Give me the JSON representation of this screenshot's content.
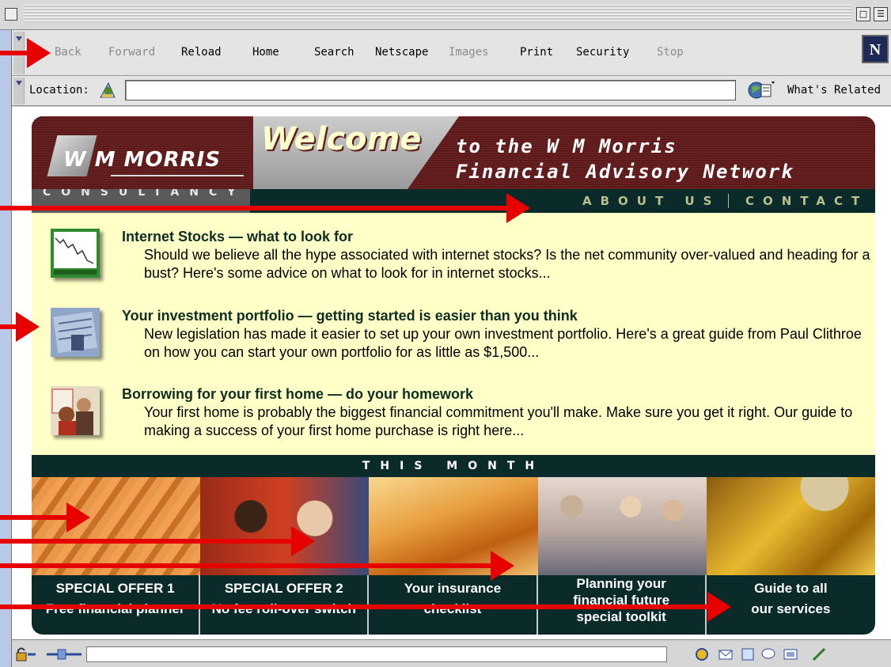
{
  "browser": {
    "nav_buttons": [
      {
        "label": "Back",
        "enabled": false
      },
      {
        "label": "Forward",
        "enabled": false
      },
      {
        "label": "Reload",
        "enabled": true
      },
      {
        "label": "Home",
        "enabled": true
      },
      {
        "label": "Search",
        "enabled": true
      },
      {
        "label": "Netscape",
        "enabled": true
      },
      {
        "label": "Images",
        "enabled": false
      },
      {
        "label": "Print",
        "enabled": true
      },
      {
        "label": "Security",
        "enabled": true
      },
      {
        "label": "Stop",
        "enabled": false
      }
    ],
    "netscape_logo": "N",
    "location_label": "Location:",
    "location_value": "",
    "whats_related": "What's Related"
  },
  "page": {
    "logo_text": "W M MORRIS",
    "logo_subtitle": "CONSULTANCY",
    "welcome": "Welcome",
    "tagline_line1": "to the W M Morris",
    "tagline_line2": "Financial Advisory Network",
    "nav": {
      "about": "ABOUT US",
      "contact": "CONTACT"
    },
    "articles": [
      {
        "title": "Internet Stocks — what to look for",
        "body": "Should we believe all the hype associated with internet stocks? Is the net community over-valued and heading for a bust? Here's some advice on what to look for in internet stocks...",
        "icon": "stock-chart-icon"
      },
      {
        "title": "Your investment portfolio — getting started is easier than you think",
        "body": "New legislation has made it easier to set up your own investment portfolio. Here's a great guide from Paul Clithroe on how you can start your own portfolio for as little as $1,500...",
        "icon": "portfolio-icon"
      },
      {
        "title": "Borrowing for your first home — do your homework",
        "body": "Your first home is probably the biggest financial commitment you'll make. Make sure you get it right. Our guide to making a success of your first home purchase is right here...",
        "icon": "first-home-icon"
      }
    ],
    "this_month": "THIS MONTH",
    "offers": [
      {
        "line1": "SPECIAL OFFER 1",
        "line2": "Free financial planner",
        "line3": ""
      },
      {
        "line1": "SPECIAL OFFER 2",
        "line2": "No fee roll-over switch",
        "line3": ""
      },
      {
        "line1": "Your insurance",
        "line2": "checklist",
        "line3": ""
      },
      {
        "line1": "Planning your",
        "line2": "financial future",
        "line3": "special toolkit"
      },
      {
        "line1": "Guide to all",
        "line2": "our services",
        "line3": ""
      }
    ]
  },
  "colors": {
    "banner": "#5e1c1c",
    "dark_teal": "#0b2a2a",
    "page_bg": "#ffffc8",
    "arrow": "#e60000"
  }
}
